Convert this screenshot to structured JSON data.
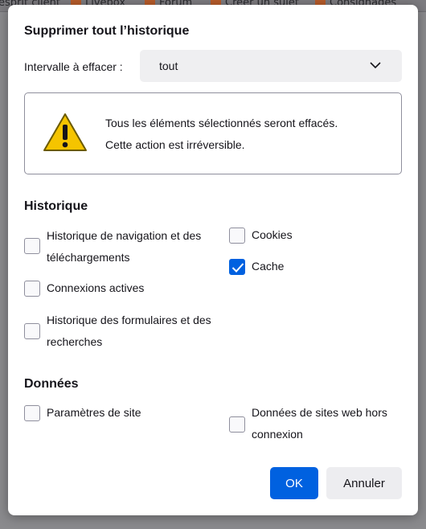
{
  "background": {
    "bookmarks": [
      "esprit client",
      "Livebox",
      "Forum",
      "Créer un sujet",
      "Consignages"
    ]
  },
  "dialog": {
    "title": "Supprimer tout l’historique",
    "range_label": "Intervalle à effacer :",
    "range_value": "tout",
    "warning": {
      "line1": "Tous les éléments sélectionnés seront effacés.",
      "line2": "Cette action est irréversible."
    },
    "history_section": {
      "title": "Historique",
      "items": [
        {
          "line1": "Historique de navigation et des",
          "line2": "téléchargements",
          "checked": false
        },
        {
          "line1": "Connexions actives",
          "checked": false
        },
        {
          "line1": "Historique des formulaires et des",
          "line2": "recherches",
          "checked": false
        },
        {
          "line1": "Cookies",
          "checked": false
        },
        {
          "line1": "Cache",
          "checked": true
        }
      ]
    },
    "data_section": {
      "title": "Données",
      "items": [
        {
          "line1": "Paramètres de site",
          "checked": false
        },
        {
          "line1": "Données de sites web hors",
          "line2": "connexion",
          "checked": false
        }
      ]
    },
    "ok_label": "OK",
    "cancel_label": "Annuler"
  },
  "colors": {
    "accent": "#0061e0",
    "warning_yellow": "#f5c400"
  }
}
